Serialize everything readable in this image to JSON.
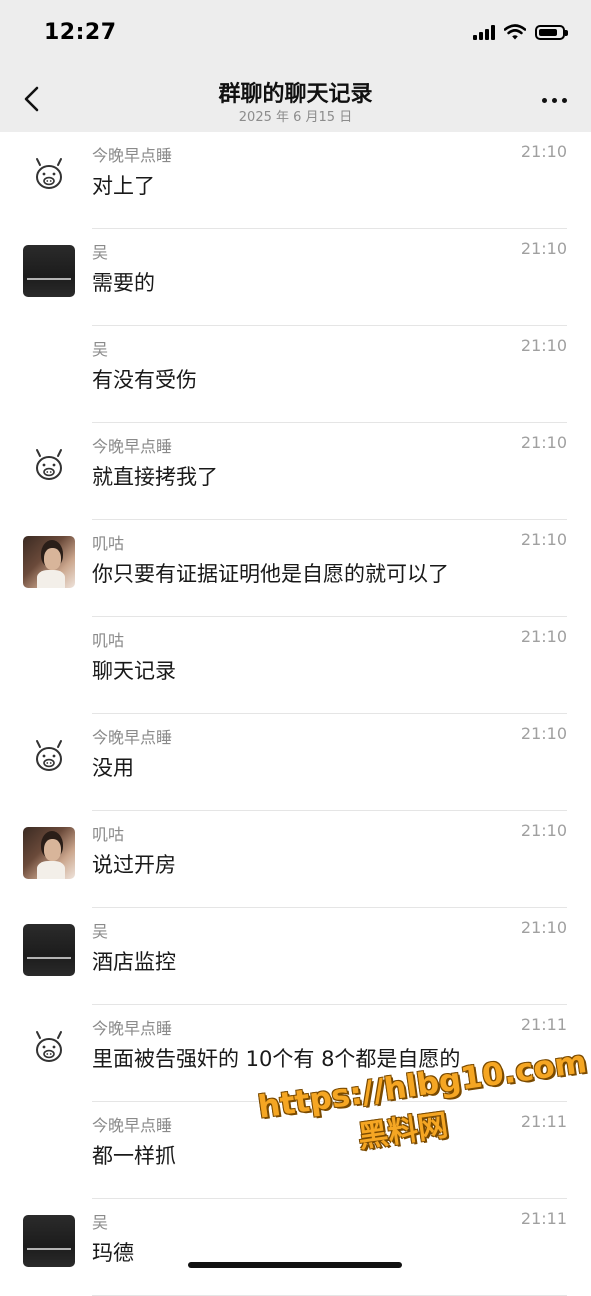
{
  "status_bar": {
    "time": "12:27"
  },
  "nav": {
    "title": "群聊的聊天记录",
    "subtitle": "2025 年 6 月15 日"
  },
  "messages": [
    {
      "sender": "今晚早点睡",
      "time": "21:10",
      "text": "对上了",
      "avatar": "pig"
    },
    {
      "sender": "吴",
      "time": "21:10",
      "text": "需要的",
      "avatar": "dark"
    },
    {
      "sender": "吴",
      "time": "21:10",
      "text": "有没有受伤",
      "avatar": "none"
    },
    {
      "sender": "今晚早点睡",
      "time": "21:10",
      "text": "就直接拷我了",
      "avatar": "pig"
    },
    {
      "sender": "叽咕",
      "time": "21:10",
      "text": "你只要有证据证明他是自愿的就可以了",
      "avatar": "photo"
    },
    {
      "sender": "叽咕",
      "time": "21:10",
      "text": "聊天记录",
      "avatar": "none"
    },
    {
      "sender": "今晚早点睡",
      "time": "21:10",
      "text": "没用",
      "avatar": "pig"
    },
    {
      "sender": "叽咕",
      "time": "21:10",
      "text": "说过开房",
      "avatar": "photo"
    },
    {
      "sender": "吴",
      "time": "21:10",
      "text": "酒店监控",
      "avatar": "dark"
    },
    {
      "sender": "今晚早点睡",
      "time": "21:11",
      "text": "里面被告强奸的 10个有 8个都是自愿的",
      "avatar": "pig"
    },
    {
      "sender": "今晚早点睡",
      "time": "21:11",
      "text": "都一样抓",
      "avatar": "none"
    },
    {
      "sender": "吴",
      "time": "21:11",
      "text": "玛德",
      "avatar": "dark"
    }
  ],
  "watermark": {
    "url": "https://hlbg10.com",
    "label": "黑料网"
  }
}
